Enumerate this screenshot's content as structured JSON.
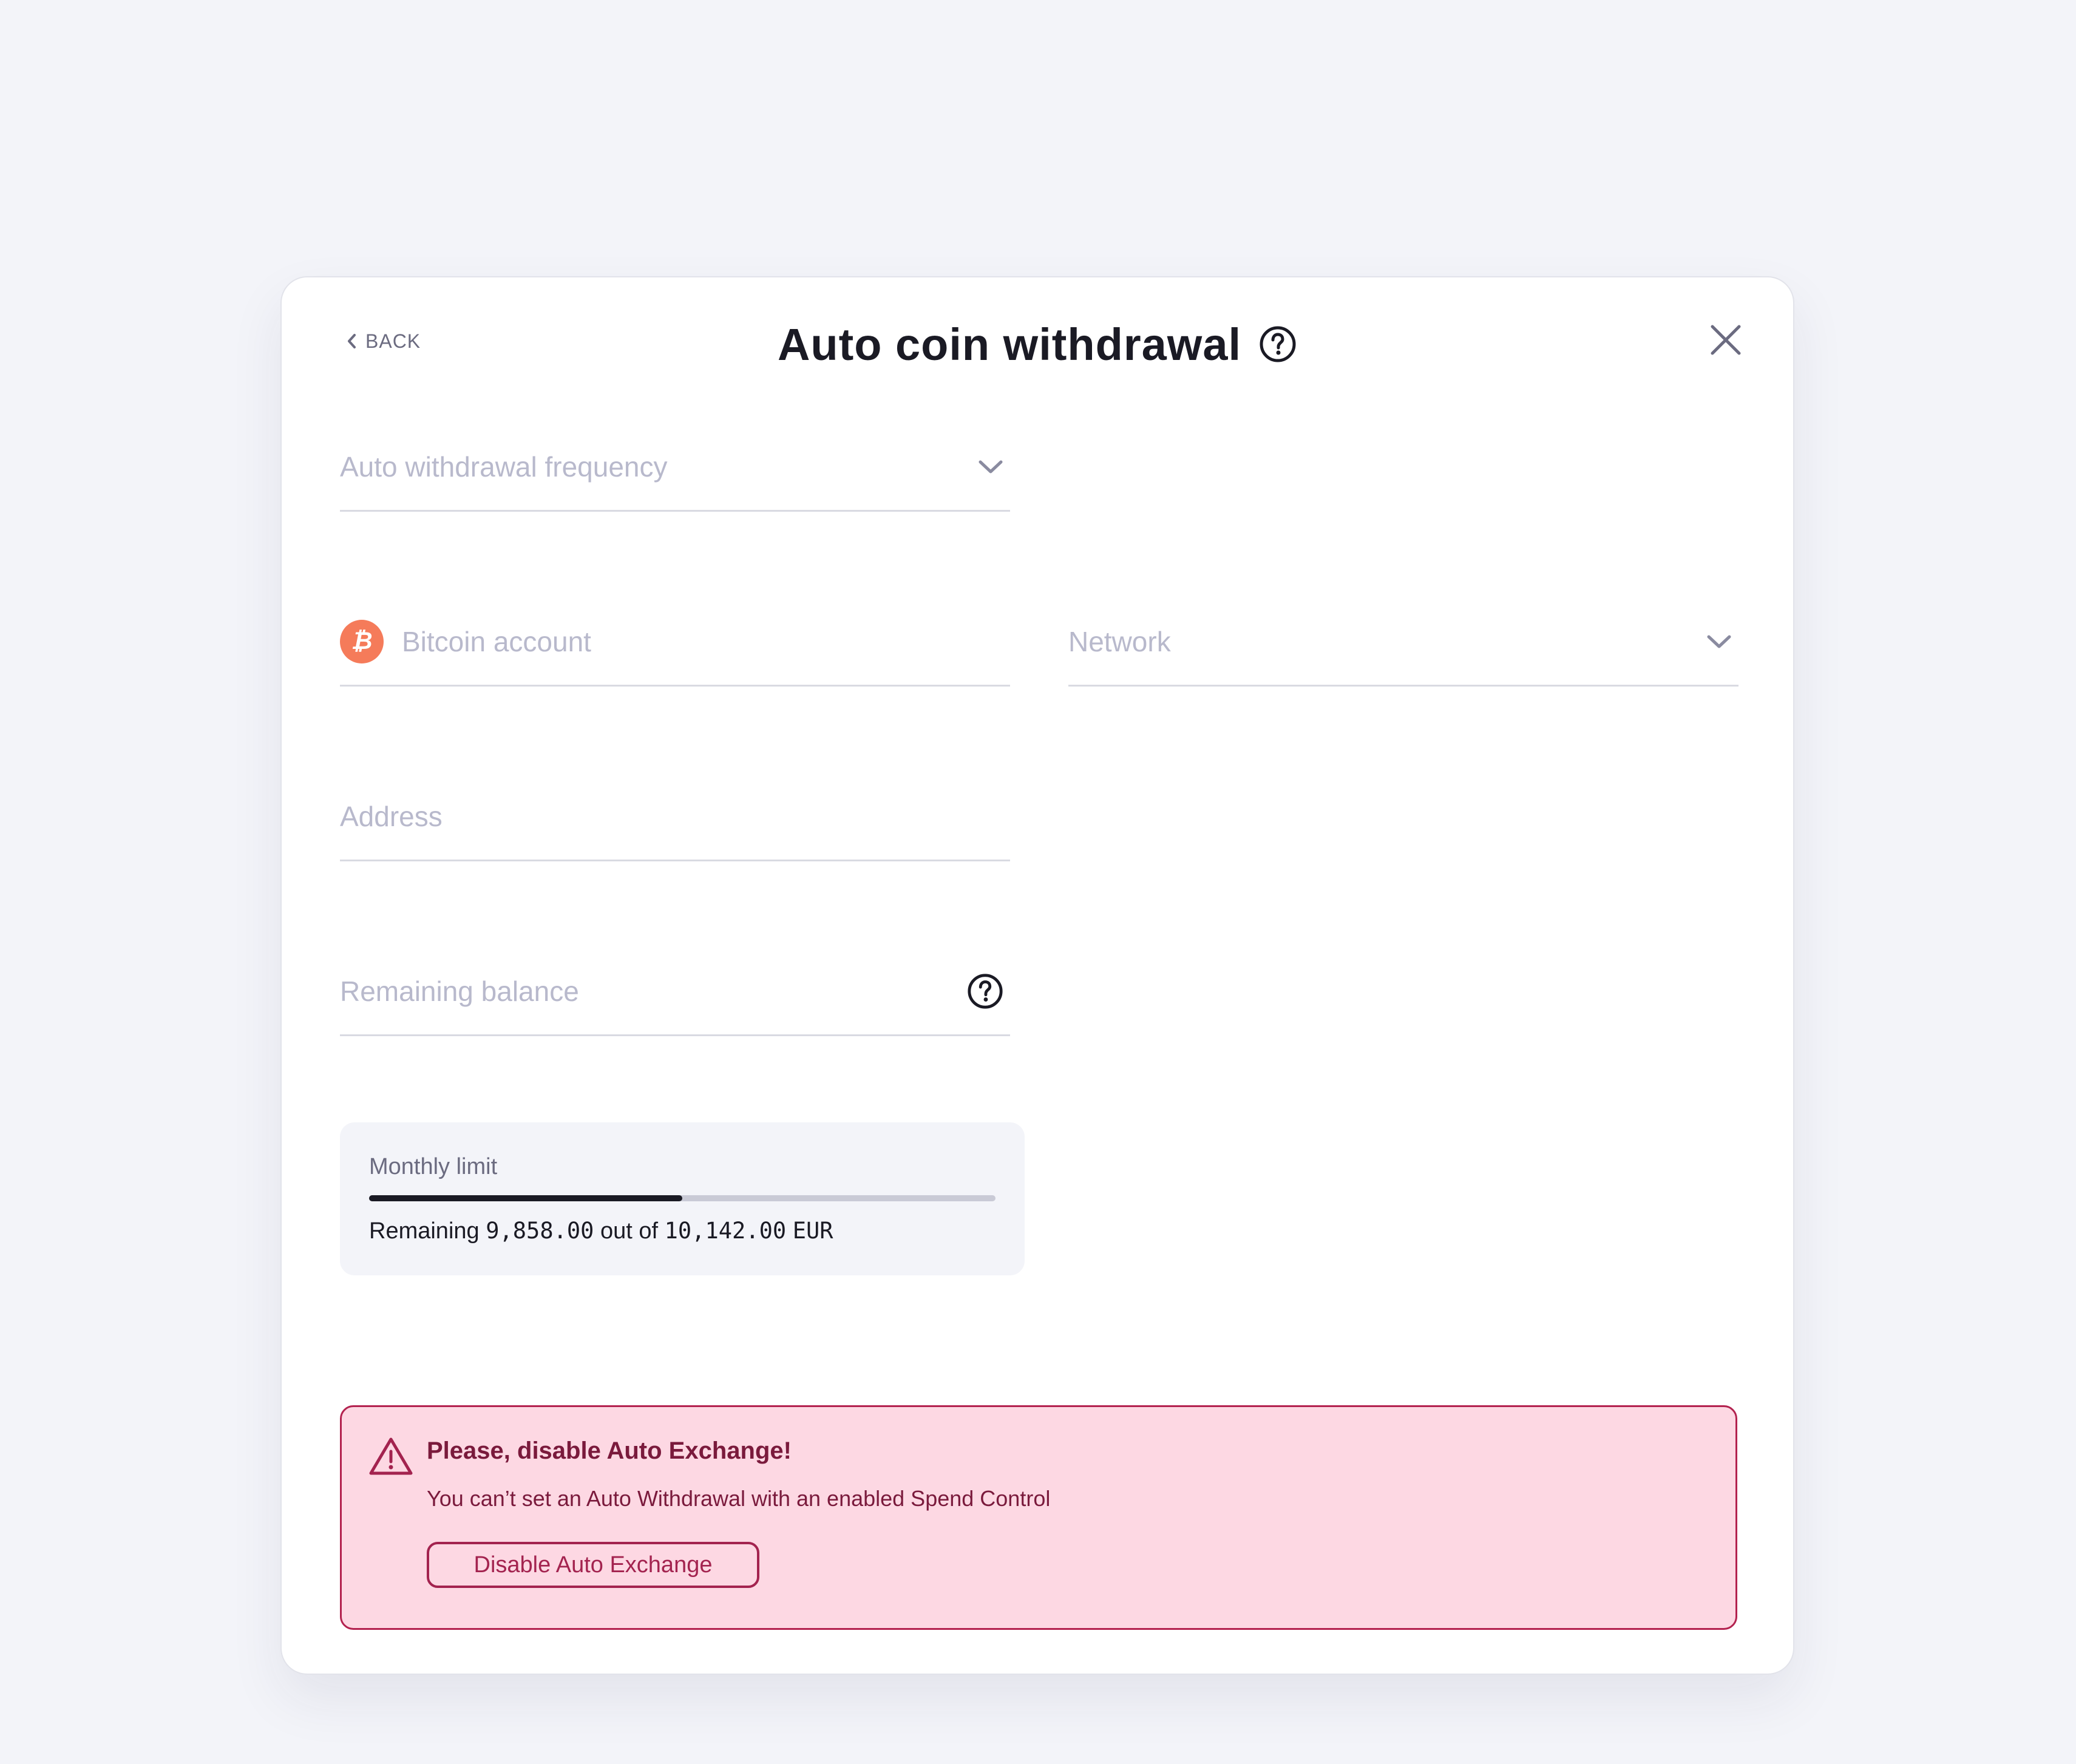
{
  "header": {
    "back_label": "BACK",
    "title": "Auto coin withdrawal"
  },
  "form": {
    "frequency_placeholder": "Auto withdrawal frequency",
    "account_placeholder": "Bitcoin account",
    "account_coin_symbol": "₿",
    "network_placeholder": "Network",
    "address_placeholder": "Address",
    "remaining_balance_placeholder": "Remaining balance"
  },
  "monthly_limit": {
    "label": "Monthly limit",
    "prefix": "Remaining",
    "remaining": "9,858.00",
    "connector": "out of",
    "total": "10,142.00",
    "currency": "EUR",
    "progress_fraction": 0.5
  },
  "alert": {
    "title": "Please, disable Auto Exchange!",
    "message": "You can’t set an Auto Withdrawal with an enabled Spend Control",
    "button_label": "Disable Auto Exchange"
  },
  "colors": {
    "page_background": "#f3f4f9",
    "bitcoin_orange": "#f57b5a",
    "alert_background": "#fdd8e3",
    "alert_accent": "#b3224f"
  }
}
